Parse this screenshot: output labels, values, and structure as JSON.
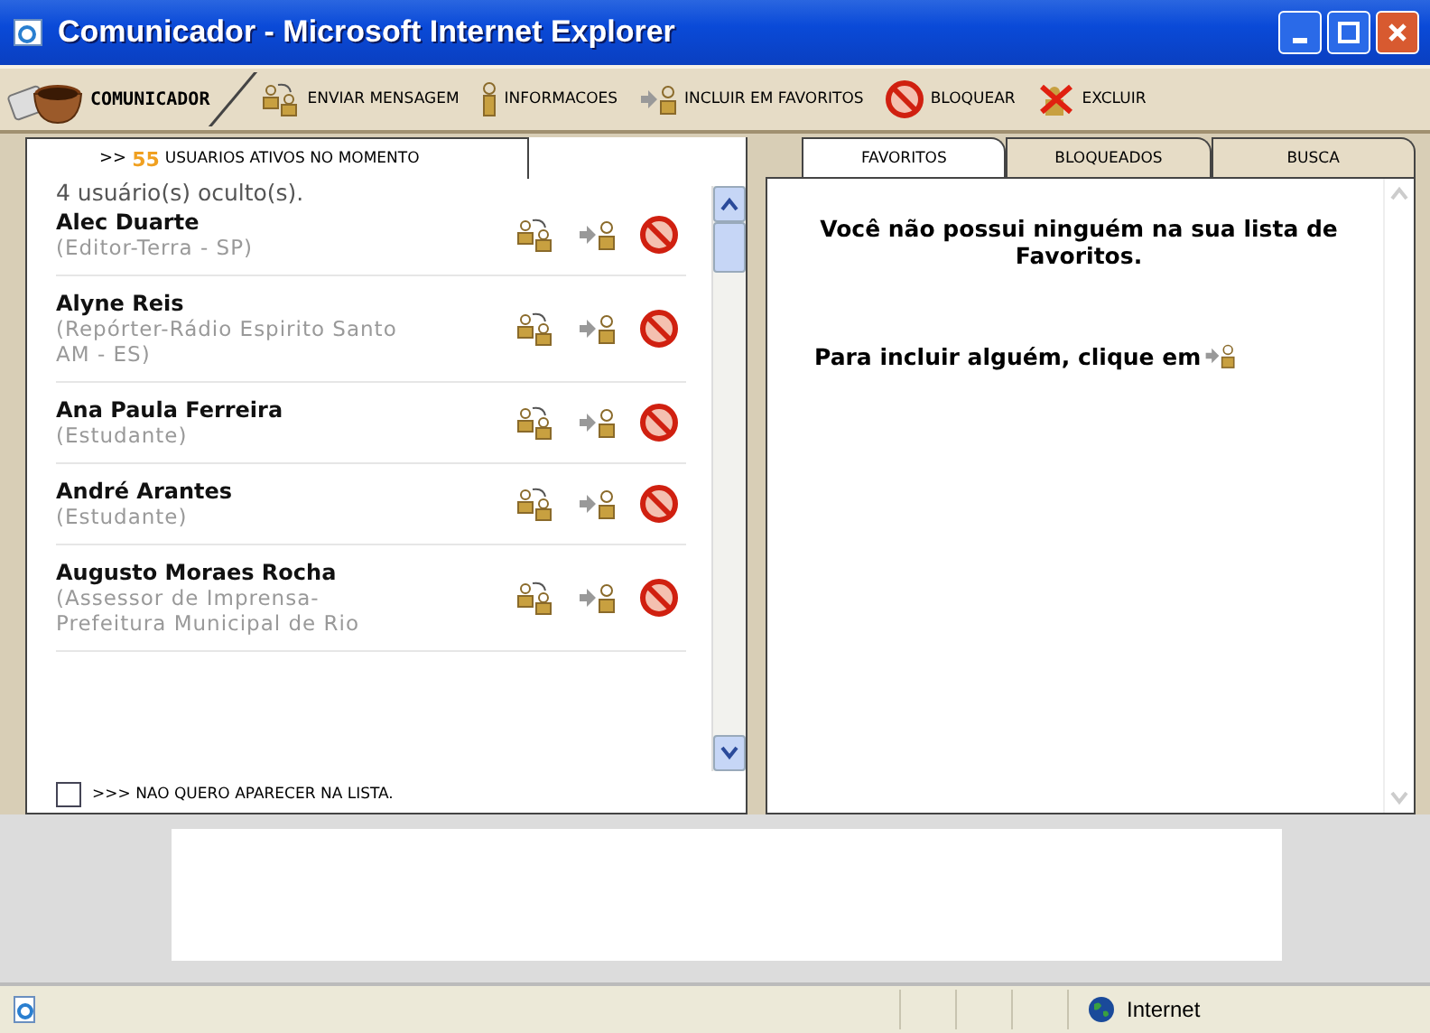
{
  "window": {
    "title": "Comunicador - Microsoft Internet Explorer"
  },
  "toolbar": {
    "logo": "COMUNICADOR",
    "actions": [
      {
        "label": "ENVIAR MENSAGEM",
        "kind": "message"
      },
      {
        "label": "INFORMACOES",
        "kind": "info"
      },
      {
        "label": "INCLUIR EM FAVORITOS",
        "kind": "favorite"
      },
      {
        "label": "BLOQUEAR",
        "kind": "block"
      },
      {
        "label": "EXCLUIR",
        "kind": "delete"
      }
    ]
  },
  "left_panel": {
    "header_prefix": ">>",
    "active_count": "55",
    "header": "USUARIOS ATIVOS NO MOMENTO",
    "hidden_note": "4 usuário(s) oculto(s).",
    "users": [
      {
        "name": "Alec Duarte",
        "role": "(Editor-Terra - SP)"
      },
      {
        "name": "Alyne Reis",
        "role": "(Repórter-Rádio Espirito Santo AM - ES)"
      },
      {
        "name": "Ana Paula Ferreira",
        "role": "(Estudante)"
      },
      {
        "name": "André Arantes",
        "role": "(Estudante)"
      },
      {
        "name": "Augusto Moraes Rocha",
        "role": "(Assessor de Imprensa-Prefeitura Municipal de Rio"
      }
    ],
    "hide_option": {
      "label": ">>> NAO QUERO APARECER NA LISTA.",
      "checked": false
    }
  },
  "right_panel": {
    "tabs": [
      {
        "label": "FAVORITOS",
        "selected": true
      },
      {
        "label": "BLOQUEADOS",
        "selected": false
      },
      {
        "label": "BUSCA",
        "selected": false
      }
    ],
    "message": "Você não possui ninguém na sua lista de Favoritos.",
    "hint": "Para incluir alguém, clique em"
  },
  "status_bar": {
    "zone": "Internet"
  }
}
